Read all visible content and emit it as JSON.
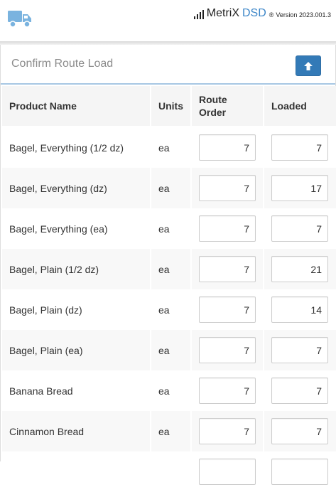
{
  "header": {
    "brand_name": "MetriX",
    "brand_suffix": "DSD",
    "registered_mark": "®",
    "version": "Version 2023.001.3",
    "logo_icon": "delivery-truck-icon",
    "signal_icon": "signal-bars-icon"
  },
  "panel": {
    "title": "Confirm Route Load",
    "upload_icon": "arrow-up-icon"
  },
  "table": {
    "columns": {
      "product_name": "Product Name",
      "units": "Units",
      "route_order_line1": "Route",
      "route_order_line2": "Order",
      "loaded": "Loaded"
    },
    "rows": [
      {
        "name": "Bagel, Everything (1/2 dz)",
        "units": "ea",
        "route_order": "7",
        "loaded": "7"
      },
      {
        "name": "Bagel, Everything (dz)",
        "units": "ea",
        "route_order": "7",
        "loaded": "17"
      },
      {
        "name": "Bagel, Everything (ea)",
        "units": "ea",
        "route_order": "7",
        "loaded": "7"
      },
      {
        "name": "Bagel, Plain (1/2 dz)",
        "units": "ea",
        "route_order": "7",
        "loaded": "21"
      },
      {
        "name": "Bagel, Plain (dz)",
        "units": "ea",
        "route_order": "7",
        "loaded": "14"
      },
      {
        "name": "Bagel, Plain (ea)",
        "units": "ea",
        "route_order": "7",
        "loaded": "7"
      },
      {
        "name": "Banana Bread",
        "units": "ea",
        "route_order": "7",
        "loaded": "7"
      },
      {
        "name": "Cinnamon Bread",
        "units": "ea",
        "route_order": "7",
        "loaded": "7"
      },
      {
        "name": "",
        "units": "",
        "route_order": "",
        "loaded": ""
      }
    ]
  },
  "colors": {
    "accent": "#337ab7",
    "brand_blue": "#3c86c8",
    "header_divider": "#a7c7e3"
  }
}
